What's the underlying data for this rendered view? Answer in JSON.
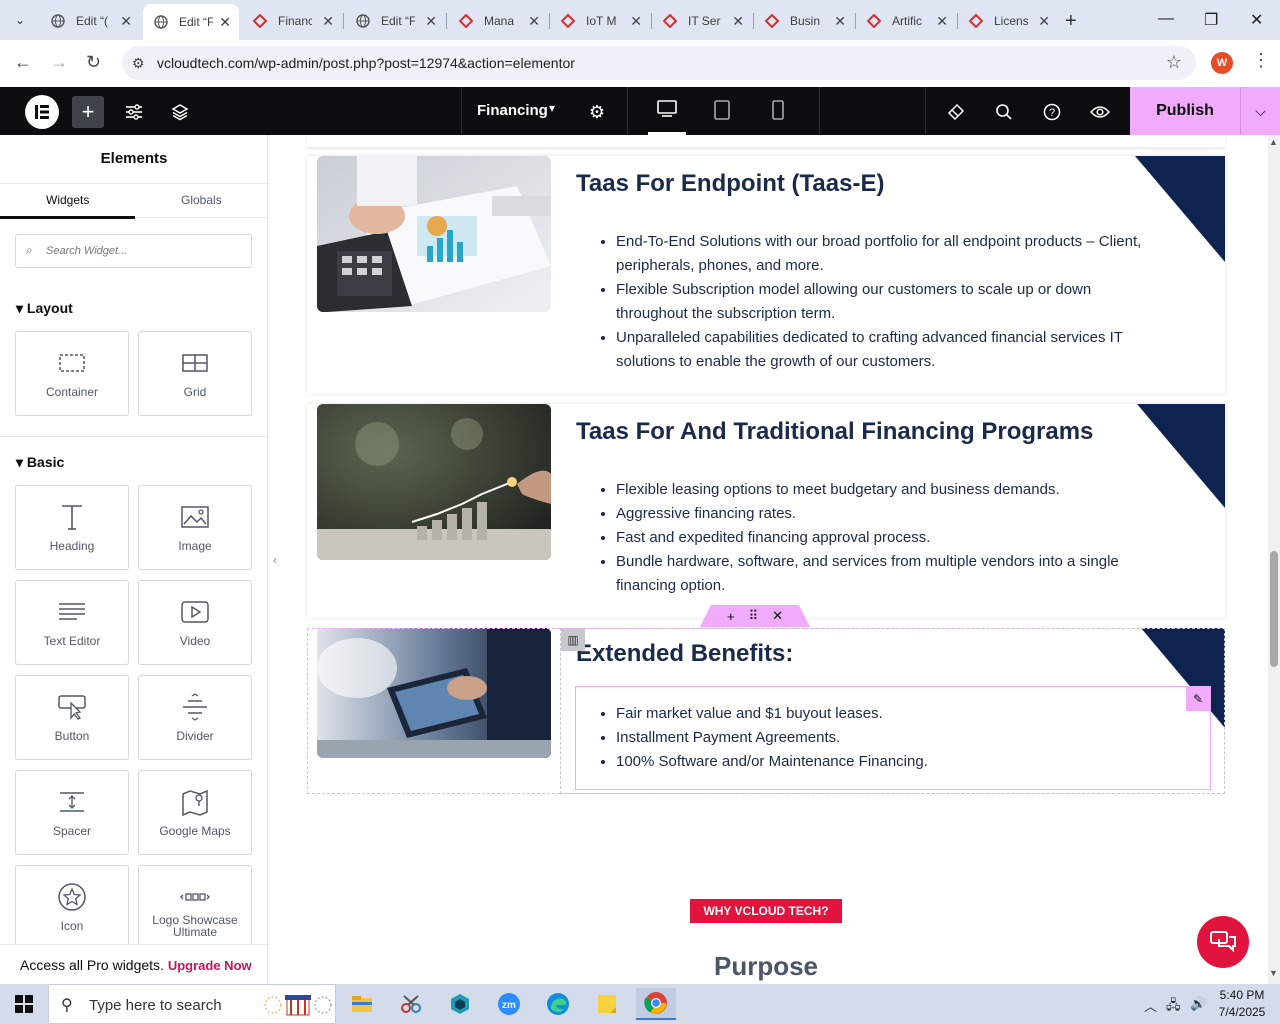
{
  "browser": {
    "tabs": [
      {
        "title": "Edit “(",
        "fav": "globe"
      },
      {
        "title": "Edit “F",
        "fav": "globe",
        "active": true
      },
      {
        "title": "Financ",
        "fav": "diamond"
      },
      {
        "title": "Edit “F",
        "fav": "globe"
      },
      {
        "title": "Mana",
        "fav": "diamond"
      },
      {
        "title": "IoT M",
        "fav": "diamond"
      },
      {
        "title": "IT Ser",
        "fav": "diamond"
      },
      {
        "title": "Busin",
        "fav": "diamond"
      },
      {
        "title": "Artific",
        "fav": "diamond"
      },
      {
        "title": "Licens",
        "fav": "diamond"
      }
    ],
    "url": "vcloudtech.com/wp-admin/post.php?post=12974&action=elementor",
    "profile_initial": "W"
  },
  "editor": {
    "page_name": "Financing",
    "publish_label": "Publish"
  },
  "panel": {
    "title": "Elements",
    "tab_widgets": "Widgets",
    "tab_globals": "Globals",
    "search_placeholder": "Search Widget...",
    "layout_heading": "Layout",
    "basic_heading": "Basic",
    "layout_widgets": [
      "Container",
      "Grid"
    ],
    "basic_widgets": [
      "Heading",
      "Image",
      "Text Editor",
      "Video",
      "Button",
      "Divider",
      "Spacer",
      "Google Maps",
      "Icon",
      "Logo Showcase Ultimate"
    ],
    "upgrade_text": "Access all Pro widgets.",
    "upgrade_link": "Upgrade Now"
  },
  "content": {
    "sections": [
      {
        "heading": "Taas For Endpoint (Taas-E)",
        "bullets": [
          "End-To-End Solutions with our broad portfolio for all endpoint products – Client, peripherals, phones, and more.",
          "Flexible Subscription model allowing our customers to scale up or down throughout the subscription term.",
          "Unparalleled capabilities dedicated to crafting advanced financial services IT solutions to enable the growth of our customers."
        ]
      },
      {
        "heading": "Taas For And Traditional Financing Programs",
        "bullets": [
          "Flexible leasing options to meet budgetary and business demands.",
          "Aggressive financing rates.",
          "Fast and expedited financing approval process.",
          "Bundle hardware, software, and services from multiple vendors into a single financing option."
        ]
      },
      {
        "heading": "Extended Benefits:",
        "bullets": [
          "Fair market value and $1 buyout leases.",
          "Installment Payment Agreements.",
          "100% Software and/or Maintenance Financing."
        ]
      }
    ],
    "why_badge": "WHY VCLOUD TECH?",
    "purpose_heading": "Purpose"
  },
  "taskbar": {
    "search_placeholder": "Type here to search",
    "time": "5:40 PM",
    "date": "7/4/2025"
  },
  "colors": {
    "accent_pink": "#f0abfc",
    "navy": "#0e2350",
    "brand_red": "#e0143c"
  }
}
